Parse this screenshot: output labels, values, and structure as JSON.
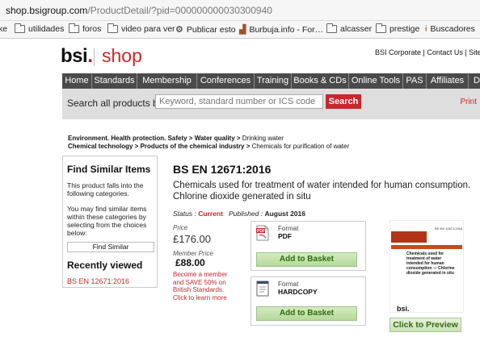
{
  "browser": {
    "url_host": "shop.bsigroup.com",
    "url_path": "/ProductDetail/?pid=000000000030300940",
    "bookmarks": [
      "ke",
      "utilidades",
      "foros",
      "video para ver",
      "Publicar esto",
      "Burbuja.info - For…",
      "alcasser",
      "prestige",
      "Buscadores"
    ]
  },
  "header": {
    "logo": "bsi",
    "logo_dot": ".",
    "shop": "shop",
    "top_links": "BSI Corporate | Contact Us | Site Map"
  },
  "nav": [
    "Home",
    "Standards",
    "Membership",
    "Conferences",
    "Training",
    "Books & CDs",
    "Online Tools",
    "PAS",
    "Affiliates",
    "D"
  ],
  "search": {
    "label": "Search all products by",
    "placeholder": "Keyword, standard number or ICS code",
    "button": "Search",
    "print": "Print"
  },
  "breadcrumb": {
    "line1_a": "Environment. Health protection. Safety >",
    "line1_b": "Water quality >",
    "line1_c": "Drinking water",
    "line2_a": "Chemical technology >",
    "line2_b": "Products of the chemical industry >",
    "line2_c": "Chemicals for purification of water"
  },
  "sidebar": {
    "title": "Find Similar Items",
    "text1": "This product falls into the following categories.",
    "text2": "You may find similar items within these categories by selecting from the choices below:",
    "find_button": "Find Similar",
    "recent_title": "Recently viewed",
    "recent_item": "BS EN 12671:2016"
  },
  "product": {
    "title": "BS EN 12671:2016",
    "description": "Chemicals used for treatment of water intended for human consumption. Chlorine dioxide generated in situ",
    "status_label": "Status :",
    "status_value": "Current",
    "published_label": "Published :",
    "published_value": "August 2016",
    "price_label": "Price",
    "price": "£176.00",
    "member_label": "Member Price",
    "member_price": "£88.00",
    "member_note": "Become a member and SAVE 50% on British Standards. Click to learn more"
  },
  "formats": [
    {
      "label": "Format",
      "value": "PDF",
      "button": "Add to Basket",
      "icon": "pdf-icon"
    },
    {
      "label": "Format",
      "value": "HARDCOPY",
      "button": "Add to Basket",
      "icon": "book-icon"
    }
  ],
  "cover": {
    "top": "BS EN 12671:2016",
    "text": "Chemicals used for treatment of water intended for human consumption — Chlorine dioxide generated in situ",
    "logo": "bsi."
  },
  "preview_button": "Click to Preview",
  "colors": {
    "brand_red": "#c8272d",
    "nav_bg": "#4a4a4a",
    "basket_green": "#2f6b10"
  }
}
